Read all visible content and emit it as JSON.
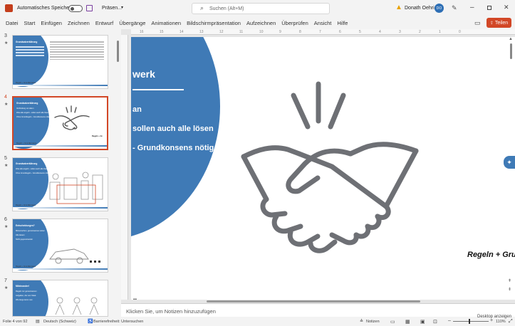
{
  "titlebar": {
    "autosave_label": "Automatisches Speichern",
    "filename": "Präsen...",
    "search_placeholder": "Suchen (Alt+M)",
    "user_name": "Donath Oehri",
    "user_initials": "DO"
  },
  "menu": {
    "items": [
      "Datei",
      "Start",
      "Einfügen",
      "Zeichnen",
      "Entwurf",
      "Übergänge",
      "Animationen",
      "Bildschirmpräsentation",
      "Aufzeichnen",
      "Überprüfen",
      "Ansicht",
      "Hilfe"
    ],
    "share_label": "Teilen"
  },
  "thumbnails": [
    {
      "num": "3",
      "title": "Grundsatzerklärung",
      "lines": [],
      "footer": "Regeln + Grundkonsens"
    },
    {
      "num": "4",
      "title": "Grundsatzerklärung",
      "lines": [
        "Verbindung vor allem",
        "Was alle angeht - sollen auch alle lösen",
        "Ohne Grundregeln - Grundkonsens nötig"
      ],
      "footer": "Regeln + Grundkonsens"
    },
    {
      "num": "5",
      "title": "Grundsatzerklärung",
      "lines": [
        "Was alle angeht - sollen auch alle lösen",
        "Ohne Grundregeln - Grundkonsens nötig"
      ],
      "footer": "Regeln + Grundkonsens"
    },
    {
      "num": "6",
      "title": "Entscheidungen?",
      "lines": [
        "Mitmenschen, gemeinsames Leben",
        "Alle lassen",
        "Nicht gegeneinander"
      ],
      "footer": "Regeln + Grundkonsens"
    },
    {
      "num": "7",
      "title": "Miteinander!",
      "lines": [
        "Regeln zur gemeinsamen",
        "Aufgaben, die vom Staat",
        "Wie lange kann man"
      ],
      "footer": ""
    }
  ],
  "slide": {
    "title": "werk",
    "lines": [
      "an",
      "sollen auch alle lösen",
      "- Grundkonsens nötig"
    ],
    "right_text": "Regeln + Gru",
    "bottom_text": "dkonsens"
  },
  "notes": {
    "placeholder": "Klicken Sie, um Notizen hinzuzufügen"
  },
  "statusbar": {
    "slide_info": "Folie 4 von 92",
    "language": "Deutsch (Schweiz)",
    "accessibility": "Barrierefreiheit: Untersuchen",
    "notes_label": "Notizen",
    "zoom": "110%",
    "desktop_label": "Desktop anzeigen"
  },
  "colors": {
    "accent": "#d24726",
    "slide_blue": "#3f7ab6"
  }
}
